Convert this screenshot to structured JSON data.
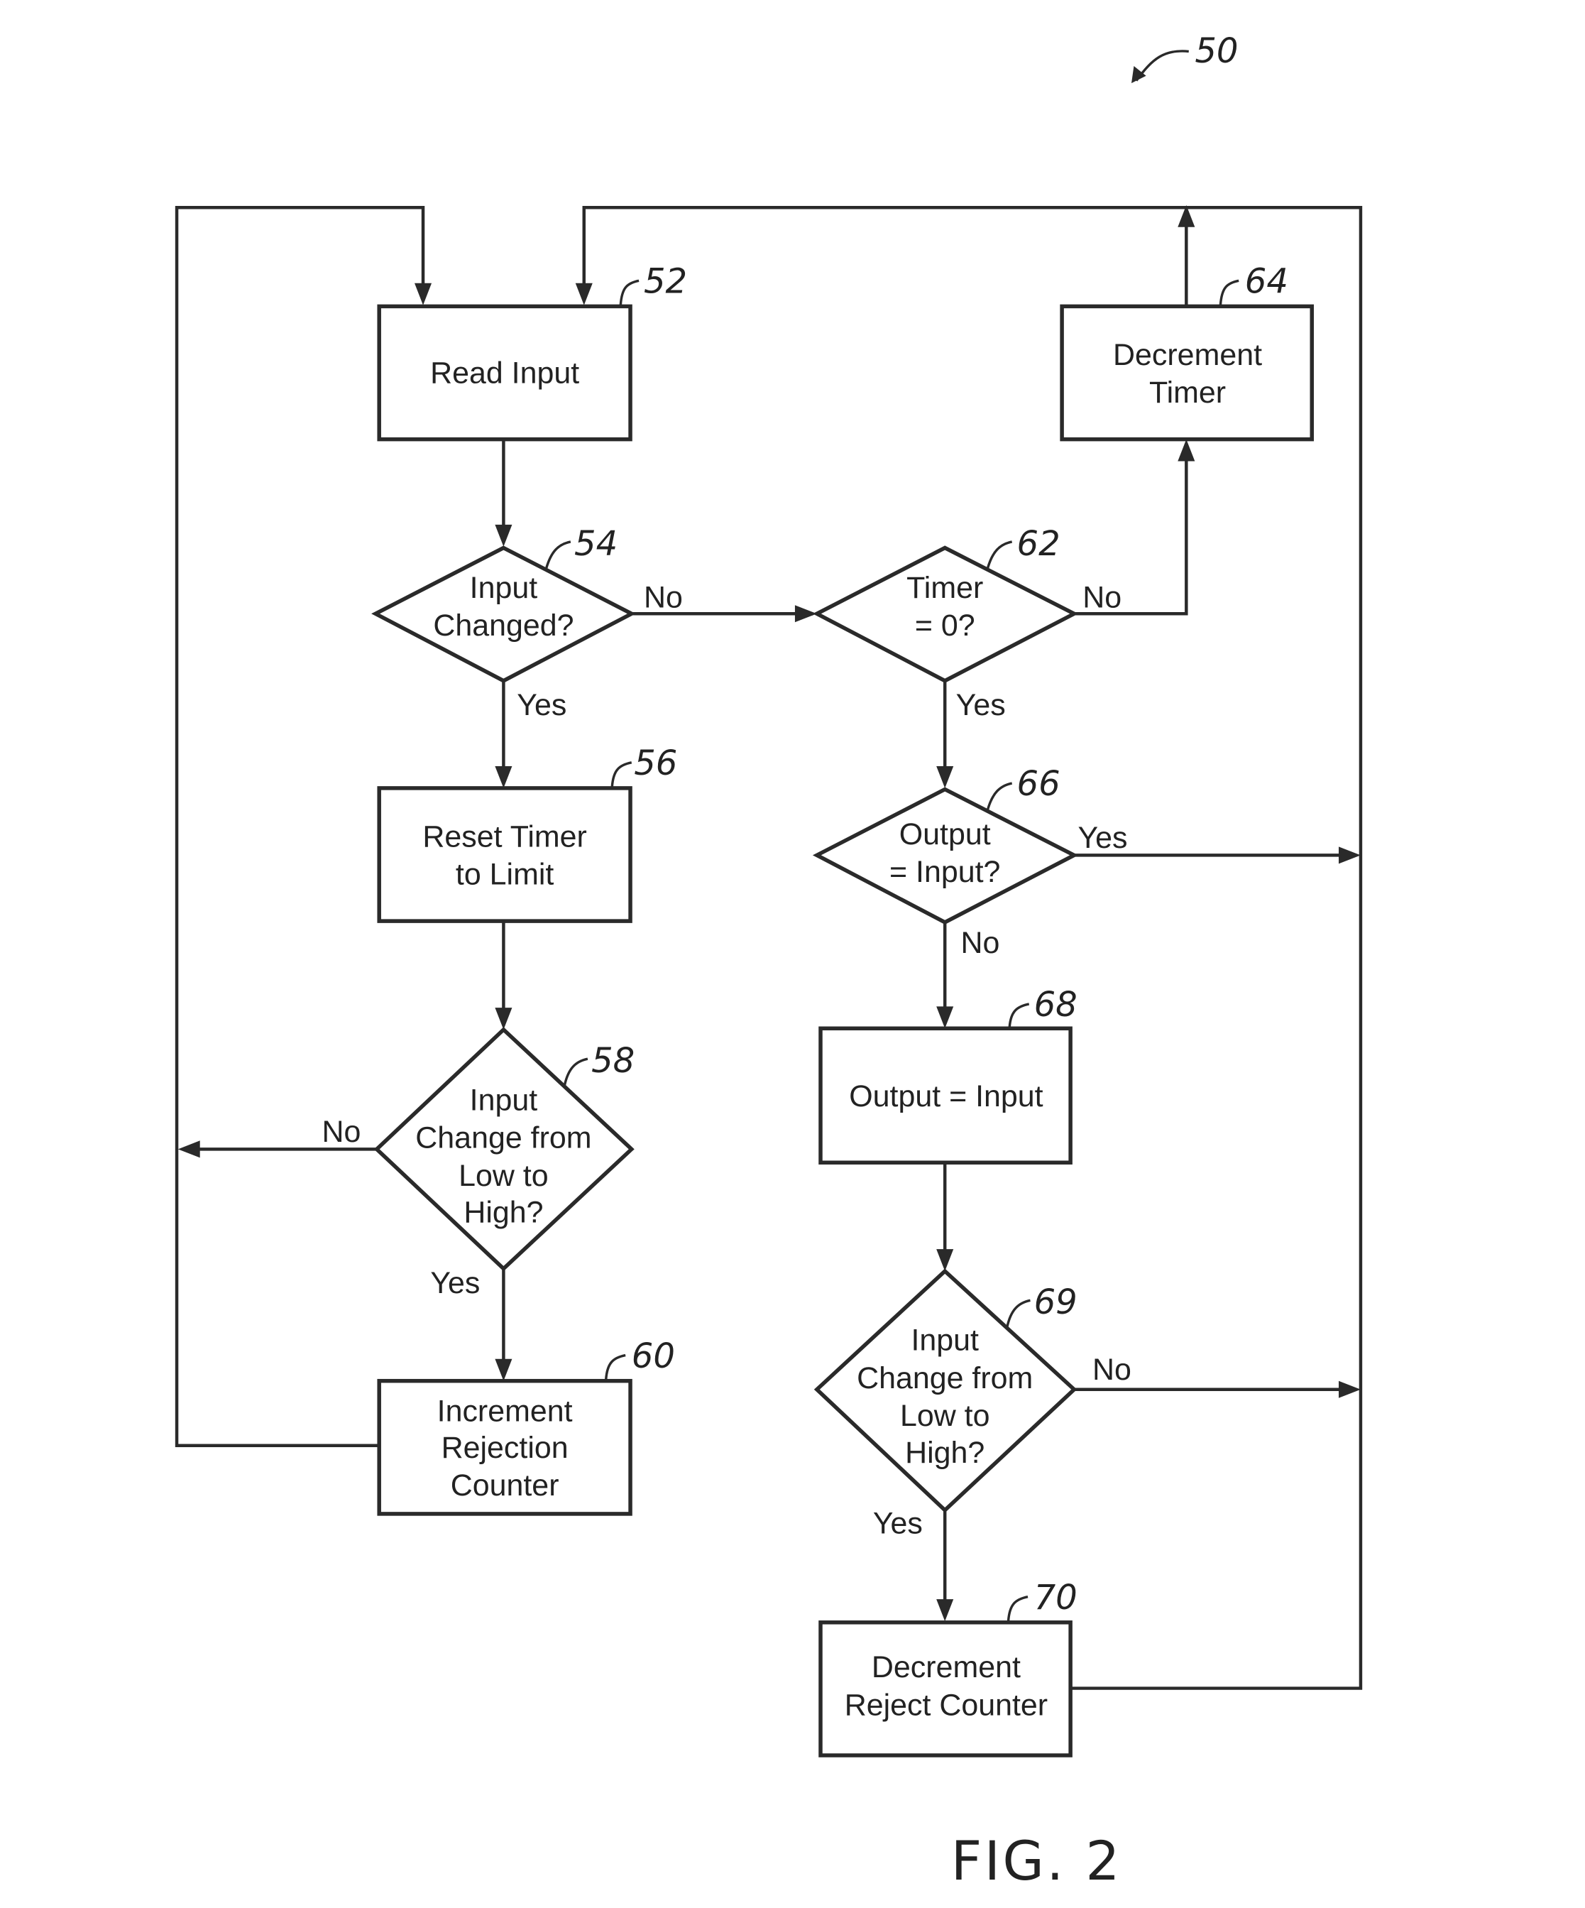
{
  "diagram": {
    "figure_label": "FIG. 2",
    "figure_ref": "50",
    "nodes": {
      "n52": {
        "ref": "52",
        "type": "process",
        "lines": [
          "Read Input"
        ]
      },
      "n54": {
        "ref": "54",
        "type": "decision",
        "lines": [
          "Input",
          "Changed?"
        ]
      },
      "n56": {
        "ref": "56",
        "type": "process",
        "lines": [
          "Reset Timer",
          "to Limit"
        ]
      },
      "n58": {
        "ref": "58",
        "type": "decision",
        "lines": [
          "Input",
          "Change from",
          "Low to",
          "High?"
        ]
      },
      "n60": {
        "ref": "60",
        "type": "process",
        "lines": [
          "Increment",
          "Rejection",
          "Counter"
        ]
      },
      "n62": {
        "ref": "62",
        "type": "decision",
        "lines": [
          "Timer",
          "= 0?"
        ]
      },
      "n64": {
        "ref": "64",
        "type": "process",
        "lines": [
          "Decrement",
          "Timer"
        ]
      },
      "n66": {
        "ref": "66",
        "type": "decision",
        "lines": [
          "Output",
          "= Input?"
        ]
      },
      "n68": {
        "ref": "68",
        "type": "process",
        "lines": [
          "Output = Input"
        ]
      },
      "n69": {
        "ref": "69",
        "type": "decision",
        "lines": [
          "Input",
          "Change from",
          "Low to",
          "High?"
        ]
      },
      "n70": {
        "ref": "70",
        "type": "process",
        "lines": [
          "Decrement",
          "Reject Counter"
        ]
      }
    },
    "edges": {
      "e54_no": "No",
      "e54_yes": "Yes",
      "e62_no": "No",
      "e62_yes": "Yes",
      "e66_yes": "Yes",
      "e66_no": "No",
      "e58_no": "No",
      "e58_yes": "Yes",
      "e69_no": "No",
      "e69_yes": "Yes"
    }
  }
}
